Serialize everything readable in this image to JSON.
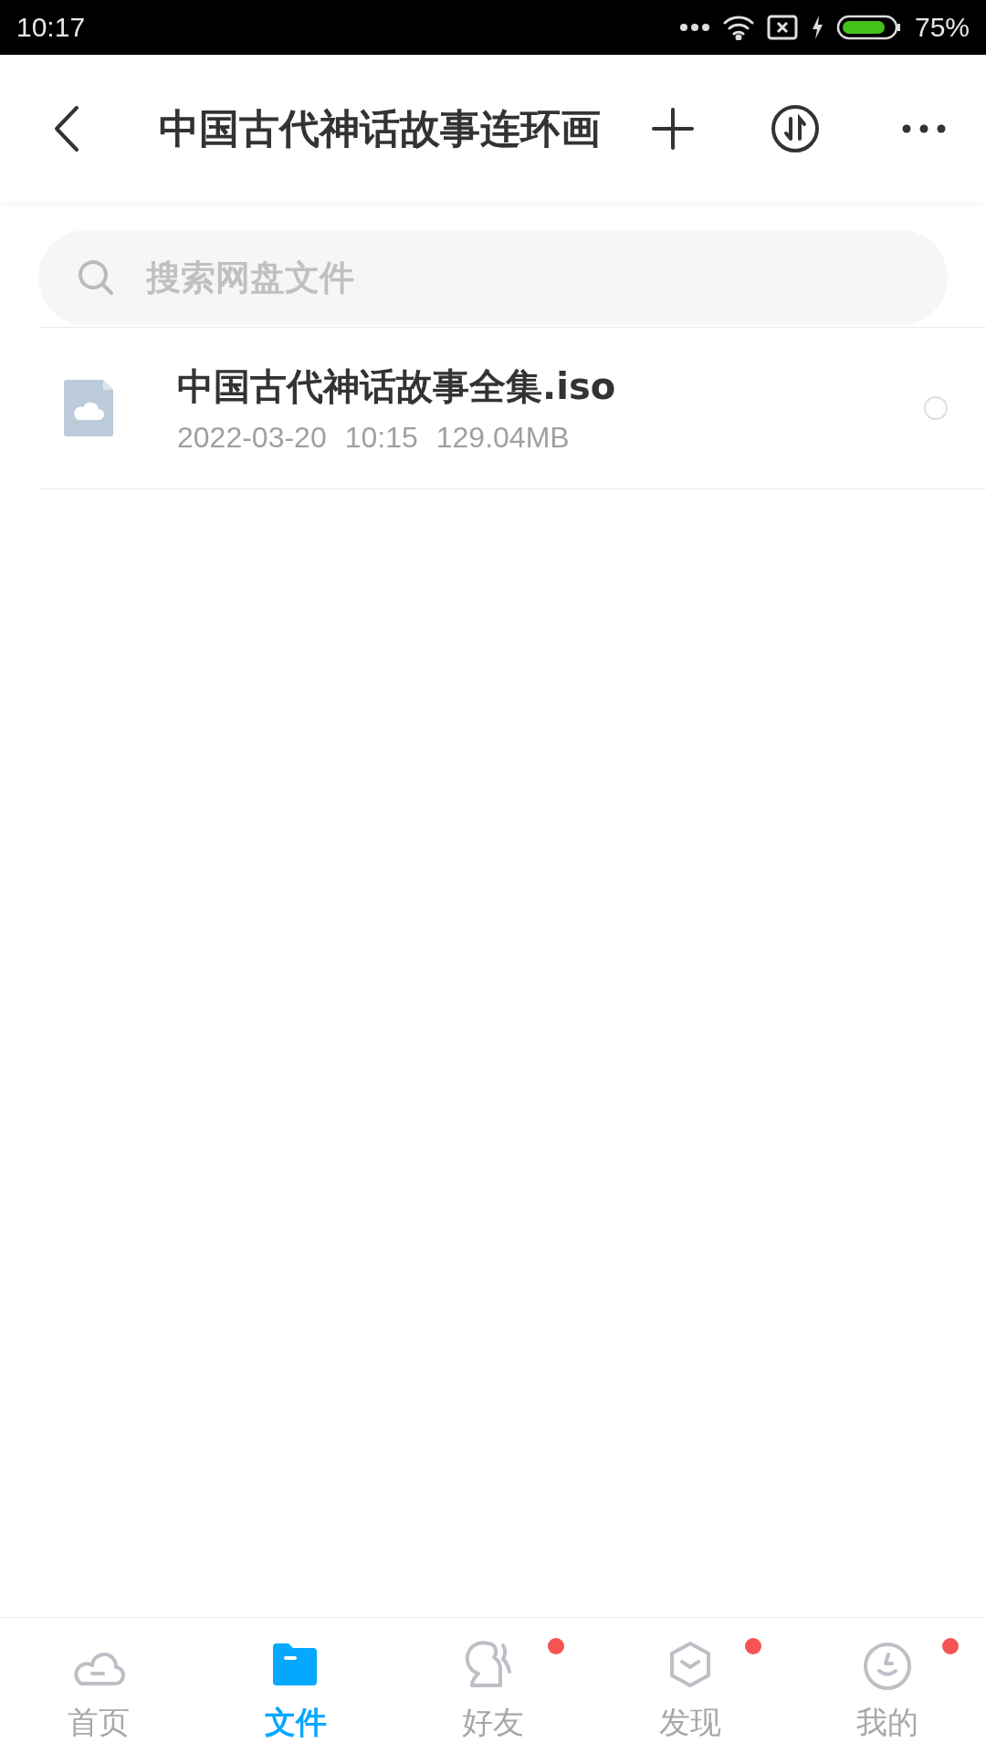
{
  "status_bar": {
    "time": "10:17",
    "battery": "75%"
  },
  "header": {
    "title": "中国古代神话故事连环画"
  },
  "search": {
    "placeholder": "搜索网盘文件"
  },
  "files": [
    {
      "name": "中国古代神话故事全集.iso",
      "date": "2022-03-20",
      "time": "10:15",
      "size": "129.04MB",
      "selected": false
    }
  ],
  "tabs": [
    {
      "kind": "home",
      "label": "首页",
      "selected": false,
      "badge": false
    },
    {
      "kind": "files",
      "label": "文件",
      "selected": true,
      "badge": false
    },
    {
      "kind": "friends",
      "label": "好友",
      "selected": false,
      "badge": true
    },
    {
      "kind": "discover",
      "label": "发现",
      "selected": false,
      "badge": true
    },
    {
      "kind": "me",
      "label": "我的",
      "selected": false,
      "badge": true
    }
  ]
}
